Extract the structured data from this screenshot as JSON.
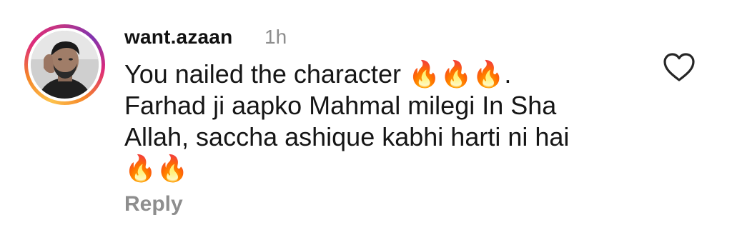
{
  "comment": {
    "username": "want.azaan",
    "time": "1h",
    "text": "You nailed the character 🔥🔥🔥.\nFarhad ji aapko Mahmal milegi  In Sha\nAllah, saccha ashique kabhi harti ni hai\n🔥🔥",
    "reply_label": "Reply",
    "like_icon": "heart-outline-icon",
    "avatar_ring_colors": [
      "#fdc24c",
      "#f58529",
      "#dd2a7b",
      "#c13584",
      "#8134af"
    ]
  }
}
